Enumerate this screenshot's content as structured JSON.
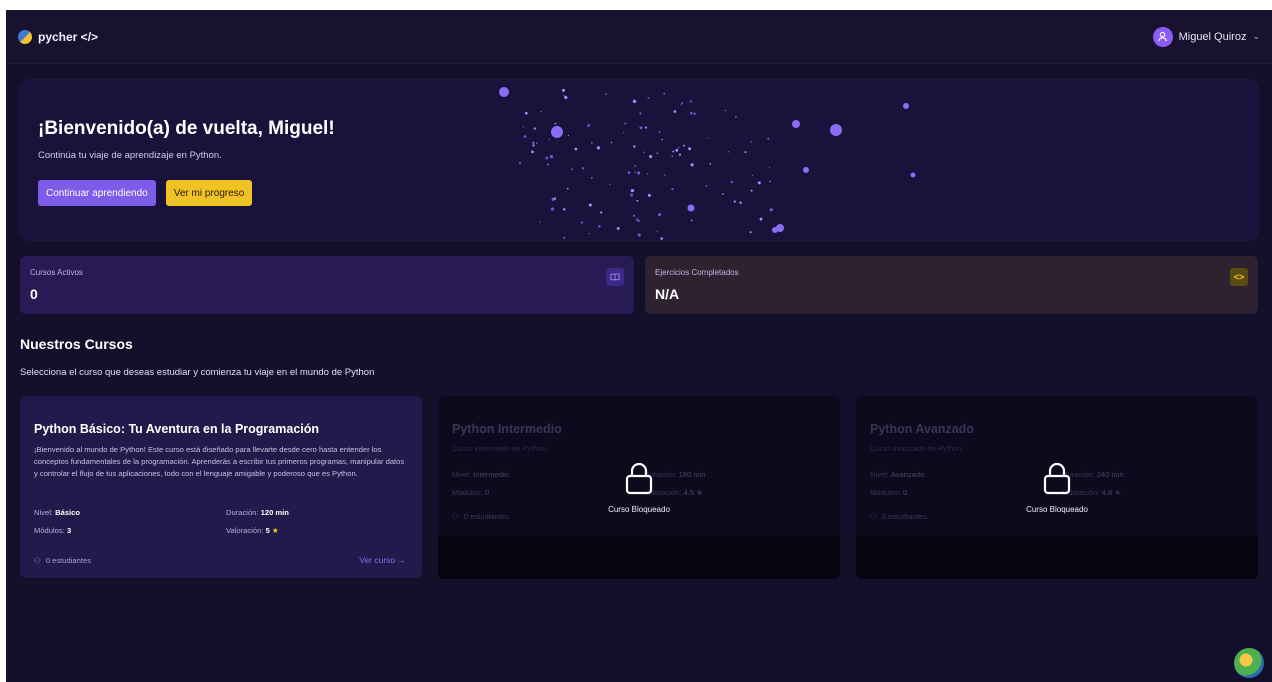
{
  "header": {
    "brand": "pycher </>",
    "user_name": "Miguel Quiroz",
    "user_icon": "user-icon",
    "chevron_icon": "chevron-down-icon"
  },
  "hero": {
    "title": "¡Bienvenido(a) de vuelta, Miguel!",
    "subtitle": "Continúa tu viaje de aprendizaje en Python.",
    "primary_button": "Continuar aprendiendo",
    "secondary_button": "Ver mi progreso"
  },
  "stats": [
    {
      "label": "Cursos Activos",
      "value": "0",
      "icon": "book-icon",
      "icon_glyph": "⧉"
    },
    {
      "label": "Ejercicios Completados",
      "value": "N/A",
      "icon": "code-icon",
      "icon_glyph": "<>"
    }
  ],
  "courses_section": {
    "title": "Nuestros Cursos",
    "subtitle": "Selecciona el curso que deseas estudiar y comienza tu viaje en el mundo de Python"
  },
  "courses": [
    {
      "title": "Python Básico: Tu Aventura en la Programación",
      "description": "¡Bienvenido al mundo de Python! Este curso está diseñado para llevarte desde cero hasta entender los conceptos fundamentales de la programación. Aprenderás a escribir tus primeros programas, manipular datos y controlar el flujo de tus aplicaciones, todo con el lenguaje amigable y poderoso que es Python.",
      "level_label": "Nivel:",
      "level": "Básico",
      "duration_label": "Duración:",
      "duration": "120 min",
      "modules_label": "Módulos:",
      "modules": "3",
      "rating_label": "Valoración:",
      "rating": "5",
      "students": "0 estudiantes",
      "link": "Ver curso →"
    },
    {
      "title": "Python Intermedio",
      "subtitle": "Curso intermedio de Python",
      "level_label": "Nivel:",
      "level": "Intermedio",
      "duration_label": "Duración:",
      "duration": "180 min",
      "modules_label": "Módulos:",
      "modules": "0",
      "rating_label": "Valoración:",
      "rating": "4.5",
      "students": "0 estudiantes",
      "locked_label": "Curso Bloqueado"
    },
    {
      "title": "Python Avanzado",
      "subtitle": "Curso avanzado de Python",
      "level_label": "Nivel:",
      "level": "Avanzado",
      "duration_label": "Duración:",
      "duration": "240 min",
      "modules_label": "Módulos:",
      "modules": "0",
      "rating_label": "Valoración:",
      "rating": "4.8",
      "students": "0 estudiantes",
      "locked_label": "Curso Bloqueado"
    }
  ],
  "colors": {
    "background": "#140f2a",
    "accent_purple": "#7c5ce8",
    "accent_yellow": "#efc324"
  }
}
